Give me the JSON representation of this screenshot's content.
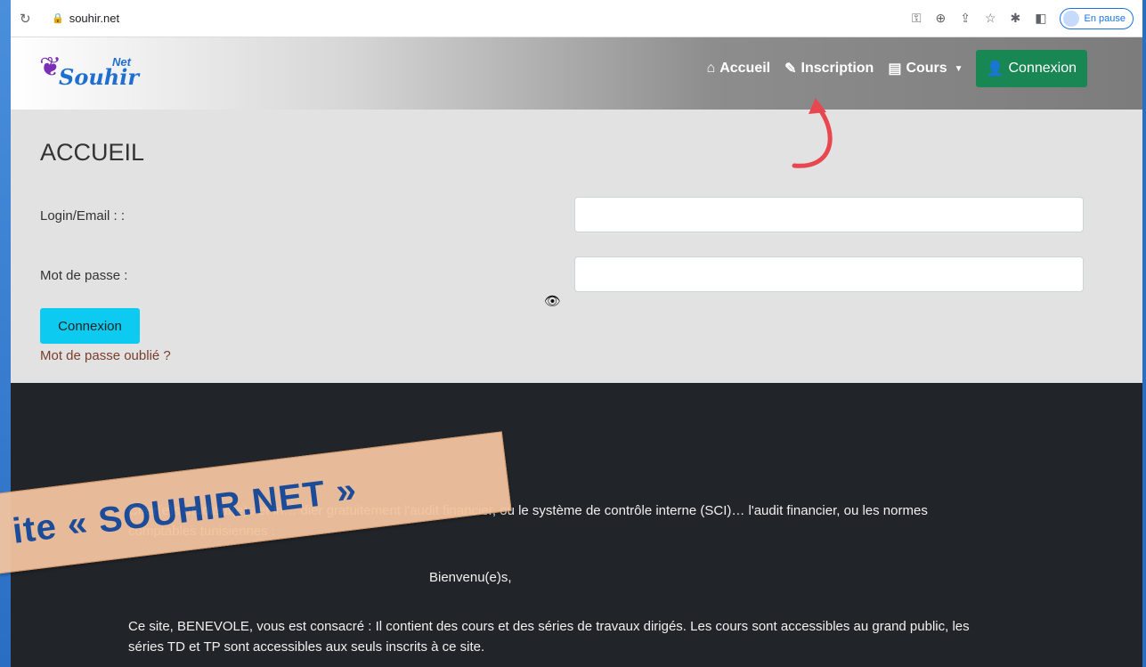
{
  "browser": {
    "url": "souhir.net",
    "profile_status": "En pause"
  },
  "navbar": {
    "logo_text": "Souhir",
    "logo_sup": "Net",
    "items": [
      {
        "label": "Accueil",
        "icon": "home-icon"
      },
      {
        "label": "Inscription",
        "icon": "edit-icon"
      },
      {
        "label": "Cours",
        "icon": "book-icon"
      }
    ],
    "connexion_label": "Connexion"
  },
  "login": {
    "title": "ACCUEIL",
    "login_label": "Login/Email : :",
    "password_label": "Mot de passe :",
    "submit_label": "Connexion",
    "forgot_label": "Mot de passe oublié ?"
  },
  "content": {
    "p1": "Cher(e)s étudiant(e)s et in… dier gratuitement l'audit financier, ou le système de contrôle interne (SCI)… l'audit financier, ou les normes comptables tunisiennes :",
    "p2": "Bienvenu(e)s,",
    "p3": "Ce site, BENEVOLE, vous est consacré : Il contient des cours et des séries de travaux dirigés. Les cours sont accessibles au grand public, les séries TD et TP sont accessibles aux seuls inscrits à ce site."
  },
  "overlay": {
    "banner_text": "ite « SOUHIR.NET »"
  },
  "colors": {
    "connexion_green": "#198754",
    "submit_cyan": "#0dcaf0",
    "content_dark": "#212529",
    "arrow_red": "#e8474f"
  }
}
